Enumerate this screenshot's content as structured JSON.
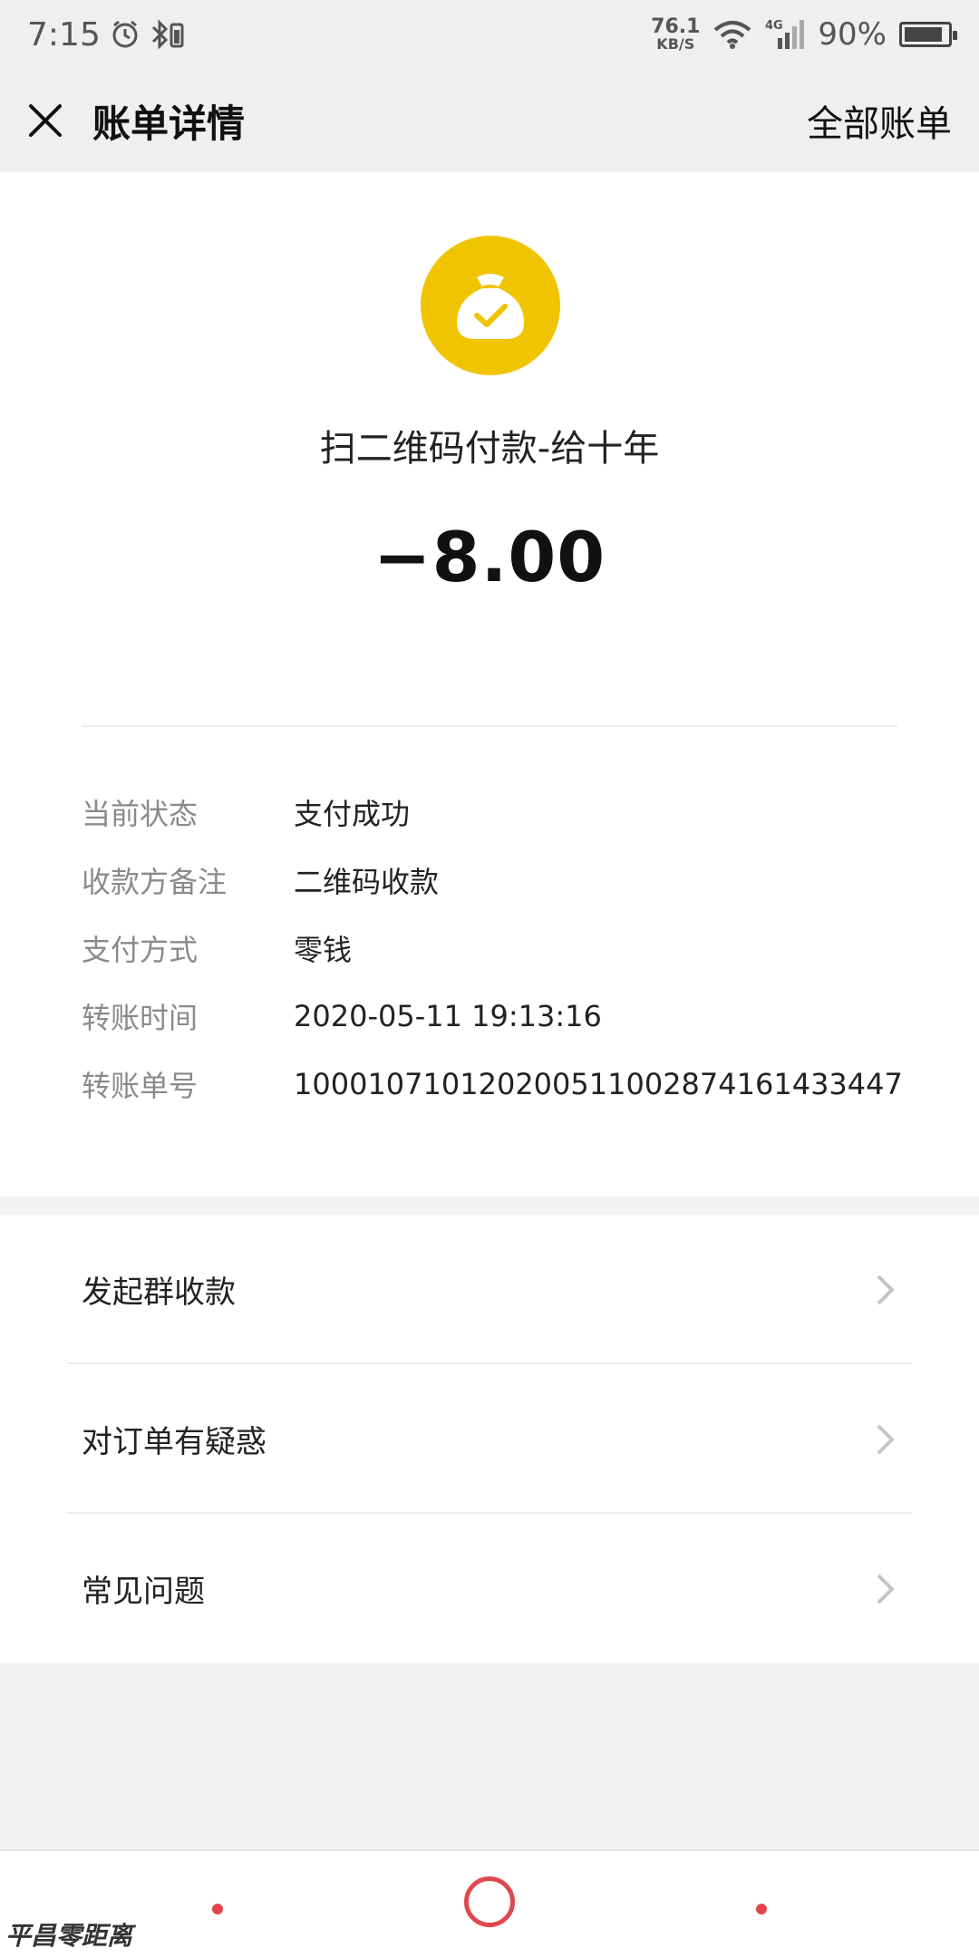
{
  "status_bar": {
    "time": "7:15",
    "net_speed_value": "76.1",
    "net_speed_unit": "KB/S",
    "network_type": "4G",
    "battery_percent": "90%",
    "battery_level": 0.9
  },
  "nav": {
    "title": "账单详情",
    "right_link": "全部账单"
  },
  "transaction": {
    "merchant": "扫二维码付款-给十年",
    "amount": "−8.00",
    "icon_color": "#f0c400"
  },
  "details": [
    {
      "label": "当前状态",
      "value": "支付成功"
    },
    {
      "label": "收款方备注",
      "value": "二维码收款"
    },
    {
      "label": "支付方式",
      "value": "零钱"
    },
    {
      "label": "转账时间",
      "value": "2020-05-11 19:13:16"
    },
    {
      "label": "转账单号",
      "value": "100010710120200511002874161433447"
    }
  ],
  "menu": [
    {
      "label": "发起群收款"
    },
    {
      "label": "对订单有疑惑"
    },
    {
      "label": "常见问题"
    }
  ],
  "accent_color": "#e0474c",
  "watermark": "平昌零距离"
}
